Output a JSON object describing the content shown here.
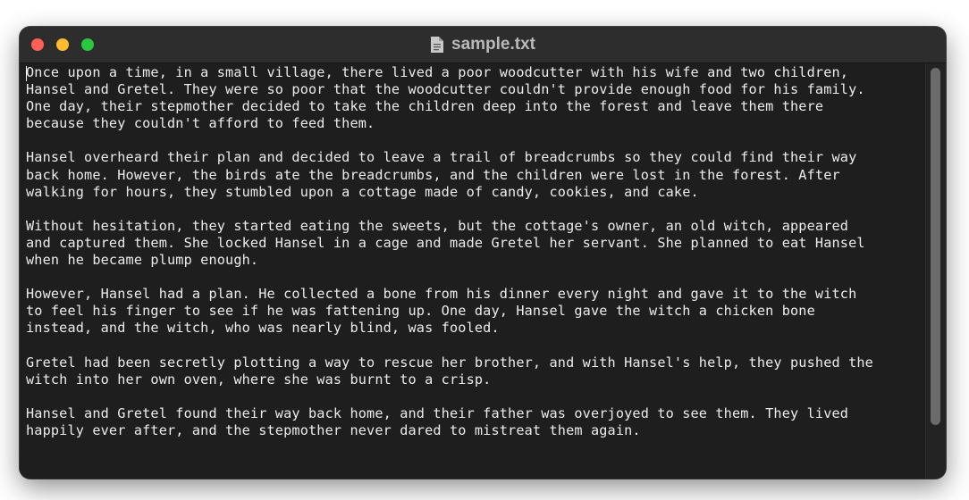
{
  "window": {
    "title": "sample.txt",
    "icon": "document-icon"
  },
  "editor": {
    "paragraphs": [
      "Once upon a time, in a small village, there lived a poor woodcutter with his wife and two children,\nHansel and Gretel. They were so poor that the woodcutter couldn't provide enough food for his family.\nOne day, their stepmother decided to take the children deep into the forest and leave them there\nbecause they couldn't afford to feed them.",
      "Hansel overheard their plan and decided to leave a trail of breadcrumbs so they could find their way\nback home. However, the birds ate the breadcrumbs, and the children were lost in the forest. After\nwalking for hours, they stumbled upon a cottage made of candy, cookies, and cake.",
      "Without hesitation, they started eating the sweets, but the cottage's owner, an old witch, appeared\nand captured them. She locked Hansel in a cage and made Gretel her servant. She planned to eat Hansel\nwhen he became plump enough.",
      "However, Hansel had a plan. He collected a bone from his dinner every night and gave it to the witch\nto feel his finger to see if he was fattening up. One day, Hansel gave the witch a chicken bone\ninstead, and the witch, who was nearly blind, was fooled.",
      "Gretel had been secretly plotting a way to rescue her brother, and with Hansel's help, they pushed the\nwitch into her own oven, where she was burnt to a crisp.",
      "Hansel and Gretel found their way back home, and their father was overjoyed to see them. They lived\nhappily ever after, and the stepmother never dared to mistreat them again."
    ]
  },
  "colors": {
    "close": "#ff5f57",
    "minimize": "#febc2e",
    "zoom": "#28c840",
    "background": "#1e1e1e",
    "text": "#ececec"
  }
}
